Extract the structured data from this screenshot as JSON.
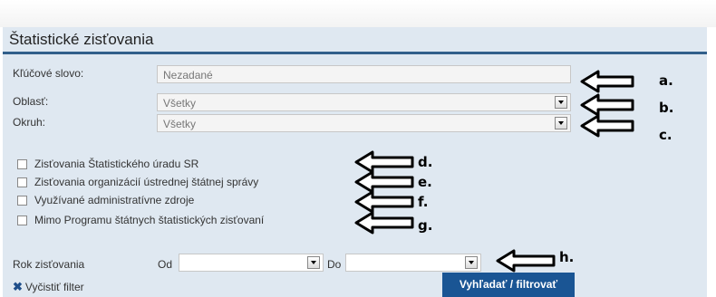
{
  "title": "Štatistické zisťovania",
  "fields": {
    "keyword": {
      "label": "Kľúčové slovo:",
      "placeholder": "Nezadané"
    },
    "area": {
      "label": "Oblasť:",
      "value": "Všetky"
    },
    "scope": {
      "label": "Okruh:",
      "value": "Všetky"
    }
  },
  "checkboxes": [
    {
      "label": "Zisťovania Štatistického úradu SR",
      "checked": false
    },
    {
      "label": "Zisťovania organizácií ústrednej štátnej správy",
      "checked": false
    },
    {
      "label": "Využívané administratívne zdroje",
      "checked": false
    },
    {
      "label": "Mimo Programu štátnych štatistických zisťovaní",
      "checked": false
    }
  ],
  "year": {
    "label": "Rok zisťovania",
    "from_label": "Od",
    "from_value": "",
    "to_label": "Do",
    "to_value": ""
  },
  "clear_filter": {
    "label": "Vyčistiť filter",
    "icon": "x-icon"
  },
  "submit": {
    "label": "Vyhľadať / filtrovať"
  },
  "annotations": [
    "a.",
    "b.",
    "c.",
    "d.",
    "e.",
    "f.",
    "g.",
    "h."
  ],
  "colors": {
    "panel": "#dfe8f1",
    "title_rule": "#315f8b",
    "button": "#1a5594"
  }
}
